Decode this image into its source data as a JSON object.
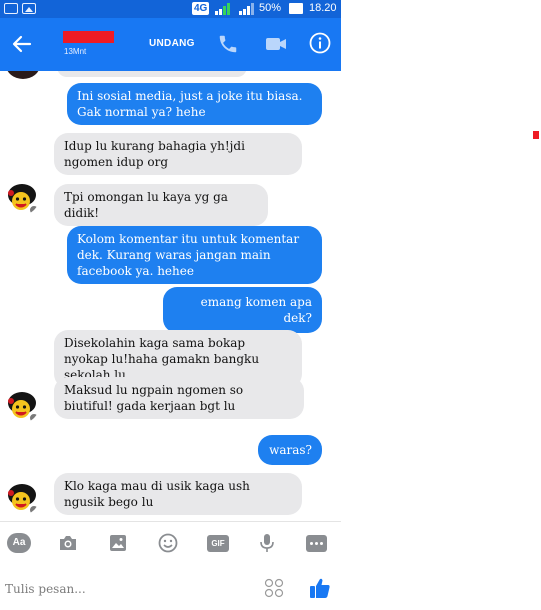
{
  "status_bar": {
    "network": "4G",
    "battery": "50%",
    "time": "18.20"
  },
  "header": {
    "contact_status": "13Mnt",
    "invite_label": "UNDANG"
  },
  "messages": [
    {
      "direction": "out",
      "text": "Ini sosial media, just a joke itu biasa. Gak normal ya? hehe"
    },
    {
      "direction": "in",
      "text": "Idup lu kurang bahagia yh!jdi ngomen idup org"
    },
    {
      "direction": "in",
      "text": "Tpi omongan lu kaya yg ga didik!"
    },
    {
      "direction": "out",
      "text": "Kolom komentar itu untuk komentar dek. Kurang waras jangan main facebook ya. hehee"
    },
    {
      "direction": "out",
      "text": "emang komen apa dek?"
    },
    {
      "direction": "in",
      "text": "Disekolahin kaga sama bokap nyokap lu!haha gamakn bangku sekolah lu"
    },
    {
      "direction": "in",
      "text": "Maksud lu ngpain ngomen so biutiful! gada kerjaan bgt lu"
    },
    {
      "direction": "out",
      "text": "waras?"
    },
    {
      "direction": "in",
      "text": "Klo kaga mau di usik kaga ush ngusik bego lu"
    }
  ],
  "toolbar": {
    "text_icon_label": "Aa",
    "gif_label": "GIF"
  },
  "composer": {
    "placeholder": "Tulis pesan..."
  },
  "colors": {
    "header": "#1878f3",
    "outgoing_bubble": "#1e80f0",
    "incoming_bubble": "#e8e8ea"
  },
  "icons": [
    "back-arrow-icon",
    "phone-call-icon",
    "video-camera-icon",
    "info-icon",
    "camera-icon",
    "image-icon",
    "smiley-icon",
    "microphone-icon",
    "more-icon",
    "emoji-grid-icon",
    "thumbs-up-icon"
  ]
}
